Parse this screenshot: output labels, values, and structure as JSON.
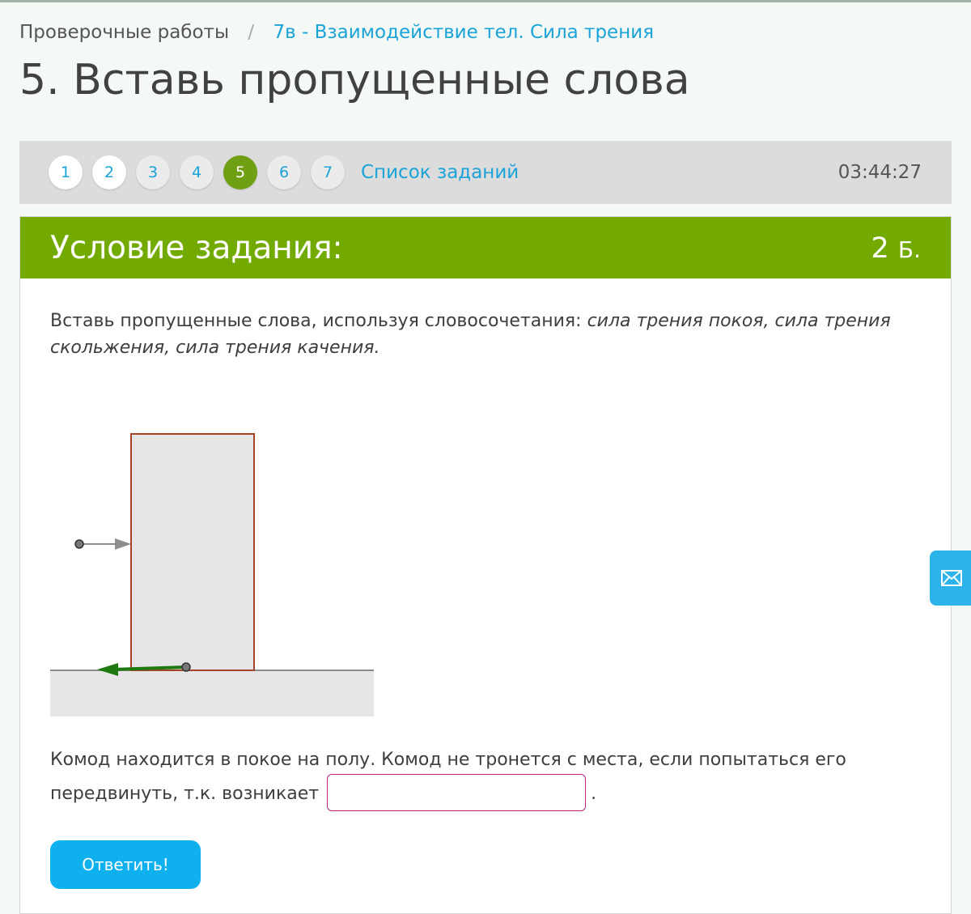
{
  "breadcrumb": {
    "root": "Проверочные работы",
    "separator": "/",
    "current": "7в - Взаимодействие тел. Сила трения"
  },
  "page_title": "5. Вставь пропущенные слова",
  "task_nav": {
    "items": [
      {
        "label": "1",
        "state": "default"
      },
      {
        "label": "2",
        "state": "default"
      },
      {
        "label": "3",
        "state": "done"
      },
      {
        "label": "4",
        "state": "done"
      },
      {
        "label": "5",
        "state": "active"
      },
      {
        "label": "6",
        "state": "done"
      },
      {
        "label": "7",
        "state": "done"
      }
    ],
    "task_list_label": "Список заданий",
    "timer": "03:44:27"
  },
  "card": {
    "title": "Условие задания:",
    "points_value": "2",
    "points_unit": "Б."
  },
  "instruction": {
    "prefix": "Вставь пропущенные слова, используя словосочетания: ",
    "options": "сила трения покоя, сила трения скольжения, сила трения качения."
  },
  "sentence": {
    "text": "Комод находится в покое на полу. Комод не тронется с места, если попытаться его передвинуть, т.к. возникает",
    "answer_value": "",
    "end": "."
  },
  "submit_label": "Ответить!",
  "icons": {
    "feedback": "envelope-icon"
  },
  "colors": {
    "accent_green": "#73aa00",
    "active_circle": "#6f9f12",
    "link_blue": "#1aa3d9",
    "button_blue": "#0fb0ee",
    "input_border": "#c0237f",
    "friction_arrow": "#1e7a10"
  }
}
